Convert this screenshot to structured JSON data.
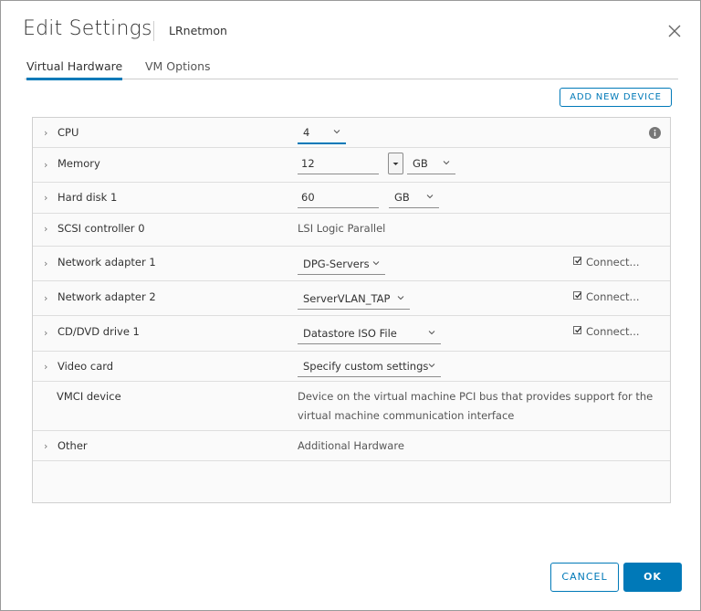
{
  "dialog": {
    "title": "Edit Settings",
    "subtitle": "LRnetmon",
    "close_icon": "close-icon"
  },
  "tabs": [
    {
      "label": "Virtual Hardware",
      "active": true
    },
    {
      "label": "VM Options",
      "active": false
    }
  ],
  "add_device_label": "ADD NEW DEVICE",
  "rows": {
    "cpu": {
      "label": "CPU",
      "value": "4"
    },
    "memory": {
      "label": "Memory",
      "value": "12",
      "unit": "GB"
    },
    "hard_disk": {
      "label": "Hard disk 1",
      "value": "60",
      "unit": "GB"
    },
    "scsi": {
      "label": "SCSI controller 0",
      "value": "LSI Logic Parallel"
    },
    "net1": {
      "label": "Network adapter 1",
      "value": "DPG-Servers",
      "connect_label": "Connect...",
      "connected": true
    },
    "net2": {
      "label": "Network adapter 2",
      "value": "ServerVLAN_TAP",
      "connect_label": "Connect...",
      "connected": true
    },
    "cd": {
      "label": "CD/DVD drive 1",
      "value": "Datastore ISO File",
      "connect_label": "Connect...",
      "connected": true
    },
    "video": {
      "label": "Video card",
      "value": "Specify custom settings"
    },
    "vmci": {
      "label": "VMCI device",
      "desc_line1": "Device on the virtual machine PCI bus that provides support for the",
      "desc_line2": "virtual machine communication interface"
    },
    "other": {
      "label": "Other",
      "value": "Additional Hardware"
    }
  },
  "footer": {
    "cancel_label": "CANCEL",
    "ok_label": "OK"
  },
  "colors": {
    "accent": "#0079b8",
    "text": "#333333",
    "panel_bg": "#fafafa",
    "border": "#d0d0d0"
  }
}
